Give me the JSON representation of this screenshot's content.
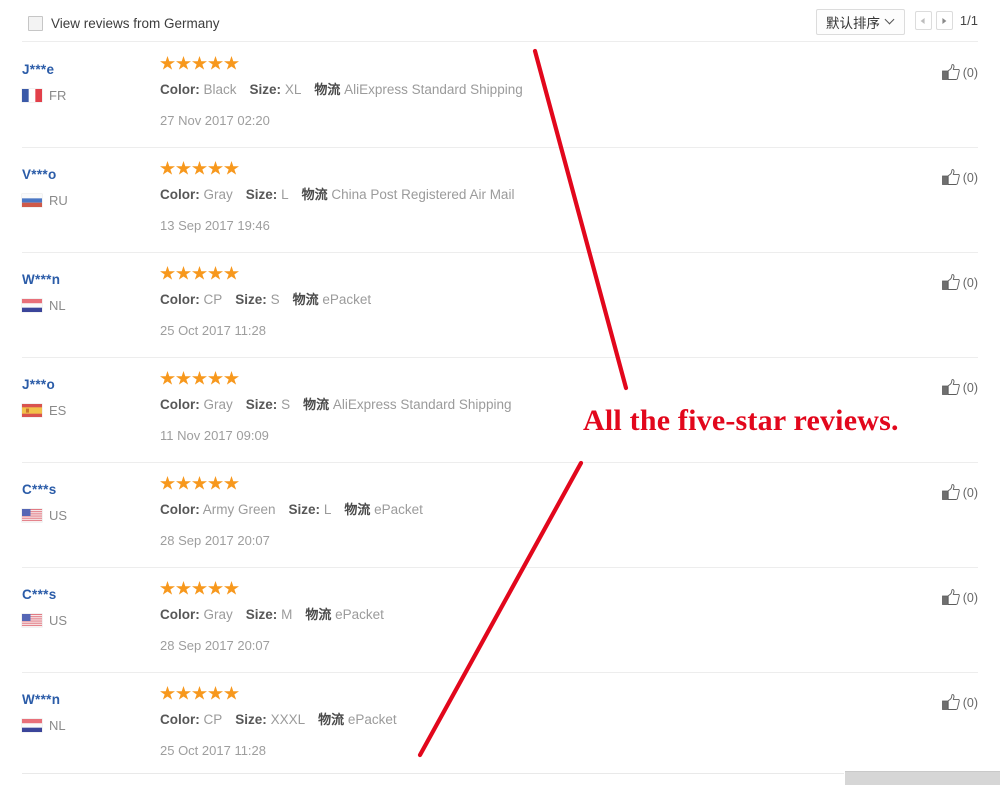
{
  "topbar": {
    "filter_label": "View reviews from Germany",
    "filter_checked": false,
    "sort_label": "默认排序",
    "page_count": "1/1"
  },
  "colors": {
    "star": "#f7981d",
    "username": "#2b5ca8",
    "annotation": "#e2071c",
    "label": "#575757",
    "value": "#9b9b9b"
  },
  "labels": {
    "color_label": "Color:",
    "size_label": "Size:",
    "logistics_label": "物流"
  },
  "annotation": {
    "text": "All the five-star reviews."
  },
  "reviews": [
    {
      "user": "J***e",
      "country_code": "FR",
      "flag": "flag-fr",
      "stars": 5,
      "color": "Black",
      "size": "XL",
      "shipping": "AliExpress Standard Shipping",
      "date": "27 Nov 2017 02:20",
      "helpful": "(0)"
    },
    {
      "user": "V***o",
      "country_code": "RU",
      "flag": "flag-ru",
      "stars": 5,
      "color": "Gray",
      "size": "L",
      "shipping": "China Post Registered Air Mail",
      "date": "13 Sep 2017 19:46",
      "helpful": "(0)"
    },
    {
      "user": "W***n",
      "country_code": "NL",
      "flag": "flag-nl",
      "stars": 5,
      "color": "CP",
      "size": "S",
      "shipping": "ePacket",
      "date": "25 Oct 2017 11:28",
      "helpful": "(0)"
    },
    {
      "user": "J***o",
      "country_code": "ES",
      "flag": "flag-es",
      "stars": 5,
      "color": "Gray",
      "size": "S",
      "shipping": "AliExpress Standard Shipping",
      "date": "11 Nov 2017 09:09",
      "helpful": "(0)"
    },
    {
      "user": "C***s",
      "country_code": "US",
      "flag": "flag-us",
      "stars": 5,
      "color": "Army Green",
      "size": "L",
      "shipping": "ePacket",
      "date": "28 Sep 2017 20:07",
      "helpful": "(0)"
    },
    {
      "user": "C***s",
      "country_code": "US",
      "flag": "flag-us",
      "stars": 5,
      "color": "Gray",
      "size": "M",
      "shipping": "ePacket",
      "date": "28 Sep 2017 20:07",
      "helpful": "(0)"
    },
    {
      "user": "W***n",
      "country_code": "NL",
      "flag": "flag-nl",
      "stars": 5,
      "color": "CP",
      "size": "XXXL",
      "shipping": "ePacket",
      "date": "25 Oct 2017 11:28",
      "helpful": "(0)"
    }
  ]
}
